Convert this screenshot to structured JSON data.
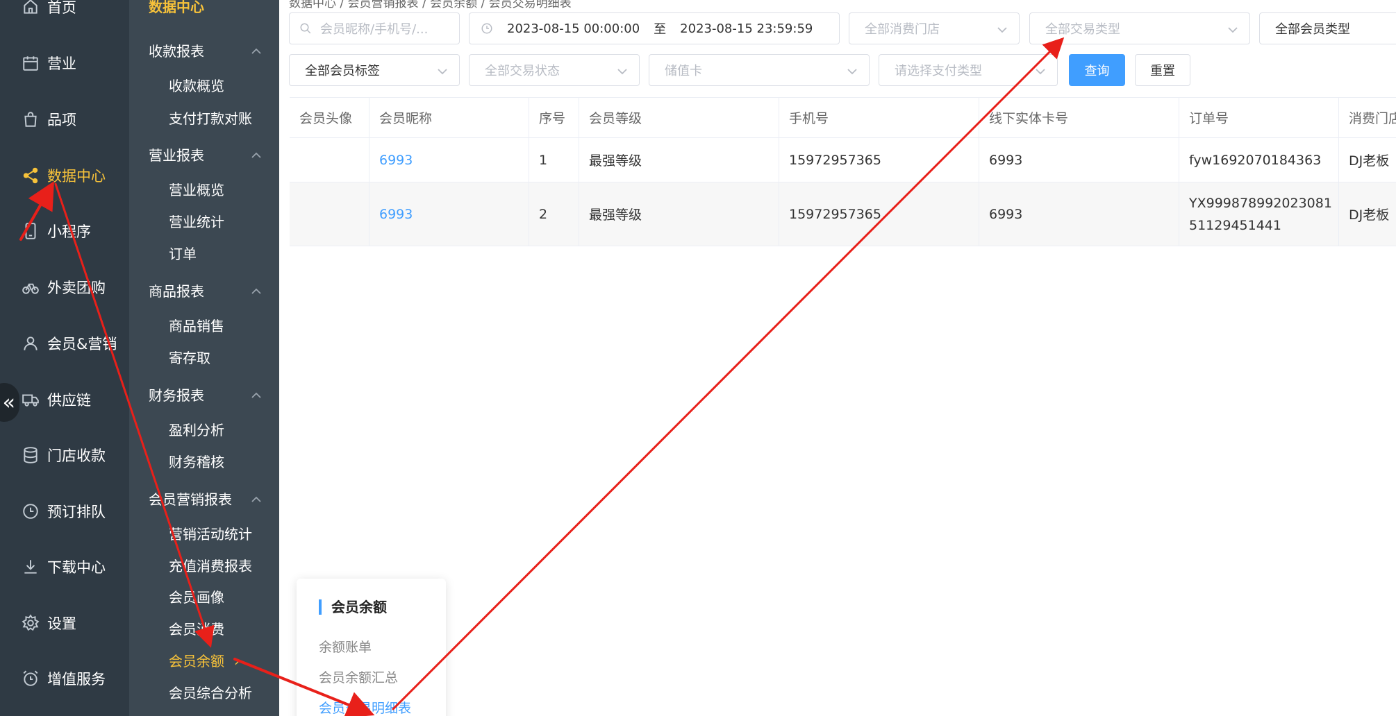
{
  "rail": {
    "items": [
      {
        "label": "首页",
        "icon": "home-icon"
      },
      {
        "label": "营业",
        "icon": "calendar-icon"
      },
      {
        "label": "品项",
        "icon": "shopping-bag-icon"
      },
      {
        "label": "数据中心",
        "icon": "share-icon"
      },
      {
        "label": "小程序",
        "icon": "mobile-icon"
      },
      {
        "label": "外卖团购",
        "icon": "bicycle-icon"
      },
      {
        "label": "会员&营销",
        "icon": "user-icon"
      },
      {
        "label": "供应链",
        "icon": "truck-icon"
      },
      {
        "label": "门店收款",
        "icon": "database-icon"
      },
      {
        "label": "预订排队",
        "icon": "clock-icon"
      },
      {
        "label": "下载中心",
        "icon": "download-icon"
      },
      {
        "label": "设置",
        "icon": "gear-icon"
      },
      {
        "label": "增值服务",
        "icon": "alarm-clock-icon"
      }
    ],
    "collapse_glyph": "«"
  },
  "submenu": {
    "title": "数据中心",
    "groups": [
      {
        "label": "收款报表",
        "items": [
          "收款概览",
          "支付打款对账"
        ]
      },
      {
        "label": "营业报表",
        "items": [
          "营业概览",
          "营业统计",
          "订单"
        ]
      },
      {
        "label": "商品报表",
        "items": [
          "商品销售",
          "寄存取"
        ]
      },
      {
        "label": "财务报表",
        "items": [
          "盈利分析",
          "财务稽核"
        ]
      },
      {
        "label": "会员营销报表",
        "items": [
          "营销活动统计",
          "充值消费报表",
          "会员画像",
          "会员消费",
          "会员余额",
          "会员综合分析"
        ]
      }
    ],
    "active_item_arrow": "›"
  },
  "breadcrumb": "数据中心  /  会员营销报表  /  会员余额  /  会员交易明细表",
  "filters": {
    "search_placeholder": "会员昵称/手机号/...",
    "date_start": "2023-08-15 00:00:00",
    "date_sep": "至",
    "date_end": "2023-08-15 23:59:59",
    "store_placeholder": "全部消费门店",
    "trade_type_placeholder": "全部交易类型",
    "member_type_value": "全部会员类型",
    "member_tag_value": "全部会员标签",
    "trade_status_placeholder": "全部交易状态",
    "card_placeholder": "储值卡",
    "pay_type_placeholder": "请选择支付类型",
    "query_label": "查询",
    "reset_label": "重置"
  },
  "table": {
    "headers": [
      "会员头像",
      "会员昵称",
      "序号",
      "会员等级",
      "手机号",
      "线下实体卡号",
      "订单号",
      "消费门店"
    ],
    "rows": [
      {
        "avatar": "",
        "nickname": "6993",
        "index": "1",
        "level": "最强等级",
        "phone": "15972957365",
        "card": "6993",
        "order": "fyw1692070184363",
        "store": "DJ老板"
      },
      {
        "avatar": "",
        "nickname": "6993",
        "index": "2",
        "level": "最强等级",
        "phone": "15972957365",
        "card": "6993",
        "order": "YX99987899202308151129451441",
        "store": "DJ老板"
      }
    ]
  },
  "popover": {
    "title": "会员余额",
    "items": [
      "余额账单",
      "会员余额汇总",
      "会员交易明细表"
    ]
  },
  "colors": {
    "rail_bg": "#2f3a44",
    "submenu_bg": "#3c4852",
    "active_yellow": "#f7c23a",
    "primary_blue": "#409eff",
    "arrow_red": "#e8201a"
  }
}
